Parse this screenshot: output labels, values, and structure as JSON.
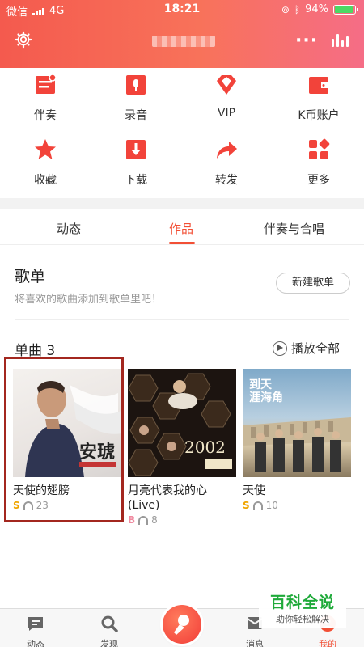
{
  "status_bar": {
    "carrier": "微信",
    "network": "4G",
    "time": "18:21",
    "battery": "94%",
    "battery_level": 0.94
  },
  "header": {
    "icons": [
      "gear-icon",
      "more-dots-icon",
      "equalizer-icon"
    ]
  },
  "grid": [
    {
      "label": "伴奏",
      "icon": "accompaniment-icon"
    },
    {
      "label": "录音",
      "icon": "record-icon"
    },
    {
      "label": "VIP",
      "icon": "vip-diamond-icon"
    },
    {
      "label": "K币账户",
      "icon": "wallet-icon"
    },
    {
      "label": "收藏",
      "icon": "star-icon"
    },
    {
      "label": "下载",
      "icon": "download-icon"
    },
    {
      "label": "转发",
      "icon": "share-arrow-icon"
    },
    {
      "label": "更多",
      "icon": "more-grid-icon"
    }
  ],
  "tabs": [
    {
      "label": "动态",
      "active": false
    },
    {
      "label": "作品",
      "active": true
    },
    {
      "label": "伴奏与合唱",
      "active": false
    }
  ],
  "playlist": {
    "title": "歌单",
    "description": "将喜欢的歌曲添加到歌单里吧！",
    "new_button": "新建歌单"
  },
  "singles": {
    "title": "单曲 3",
    "play_all": "播放全部",
    "items": [
      {
        "title": "天使的翅膀",
        "level": "S",
        "plays": "23",
        "level_color": "#f0a500"
      },
      {
        "title": "月亮代表我的心(Live)",
        "level": "B",
        "plays": "8",
        "level_color": "#f08aa0"
      },
      {
        "title": "天使",
        "level": "S",
        "plays": "10",
        "level_color": "#f0a500"
      }
    ]
  },
  "watermark": {
    "title": "百科全说",
    "subtitle": "助你轻松解决"
  },
  "bottom_nav": [
    {
      "label": "动态",
      "icon": "feed-icon"
    },
    {
      "label": "发现",
      "icon": "discover-search-icon"
    },
    {
      "label": "",
      "icon": "sing-microphone-icon"
    },
    {
      "label": "消息",
      "icon": "message-icon"
    },
    {
      "label": "我的",
      "icon": "profile-icon",
      "active": true
    }
  ],
  "colors": {
    "accent": "#f24f35",
    "header_start": "#f45a4e",
    "header_end": "#f56d86"
  }
}
